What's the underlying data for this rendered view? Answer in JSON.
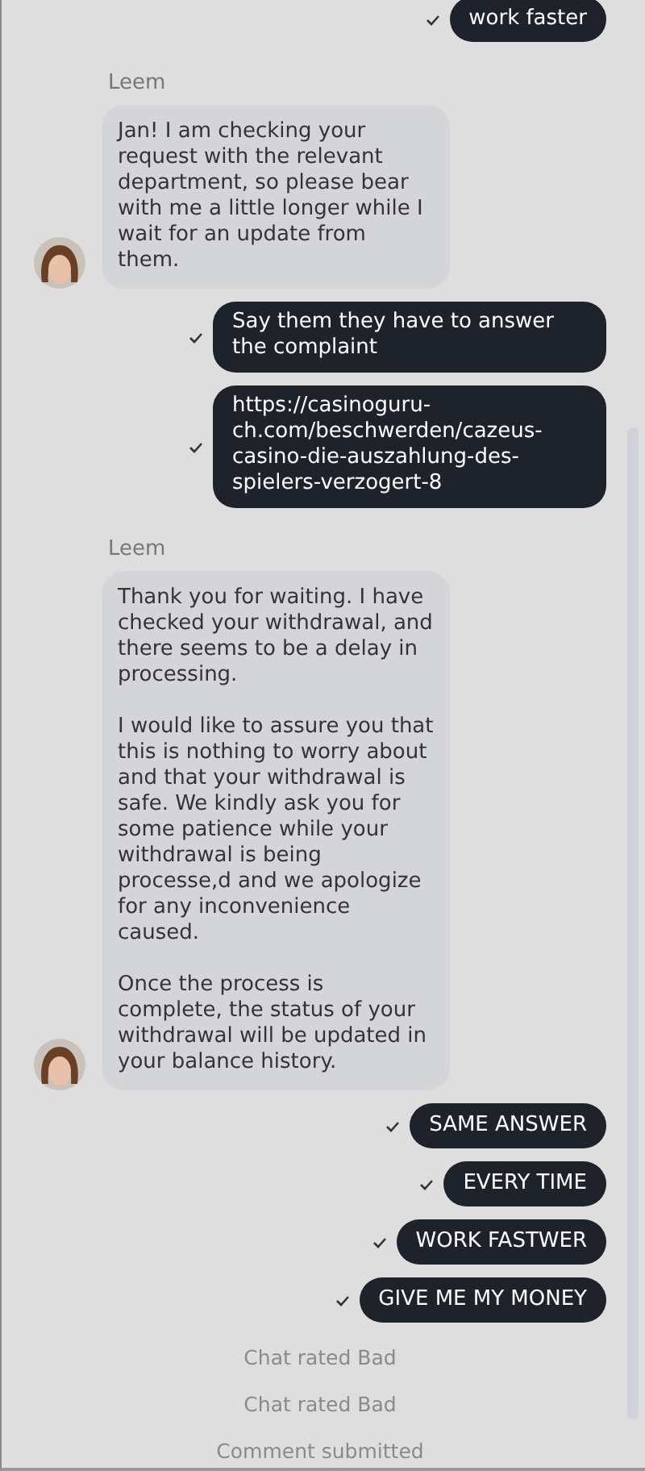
{
  "messages": [
    {
      "kind": "user",
      "text": "work faster",
      "delivered": true
    },
    {
      "kind": "agent",
      "name": "Leem",
      "text": "Jan! I am checking your request with the relevant department, so please bear with me a little longer while I wait for an update from them."
    },
    {
      "kind": "user",
      "text": "Say them they have to answer the complaint",
      "delivered": true
    },
    {
      "kind": "user",
      "text": "https://casinoguru-ch.com/beschwerden/cazeus-casino-die-auszahlung-des-spielers-verzogert-8",
      "delivered": true
    },
    {
      "kind": "agent",
      "name": "Leem",
      "text": "Thank you for waiting. I have checked your withdrawal, and there seems to be a delay in processing.\n\nI would like to assure you that this is nothing to worry about and that your withdrawal is safe. We kindly ask you for some patience while your withdrawal is being processe,d and we apologize for any inconvenience caused.\n\nOnce the process is complete, the status of your withdrawal will be updated in your balance history."
    },
    {
      "kind": "user",
      "text": "SAME ANSWER",
      "delivered": true
    },
    {
      "kind": "user",
      "text": "EVERY TIME",
      "delivered": true
    },
    {
      "kind": "user",
      "text": "WORK FASTWER",
      "delivered": true
    },
    {
      "kind": "user",
      "text": "GIVE ME MY MONEY",
      "delivered": true
    },
    {
      "kind": "status",
      "text": "Chat rated Bad"
    },
    {
      "kind": "status",
      "text": "Chat rated Bad"
    },
    {
      "kind": "status",
      "text": "Comment submitted"
    }
  ]
}
